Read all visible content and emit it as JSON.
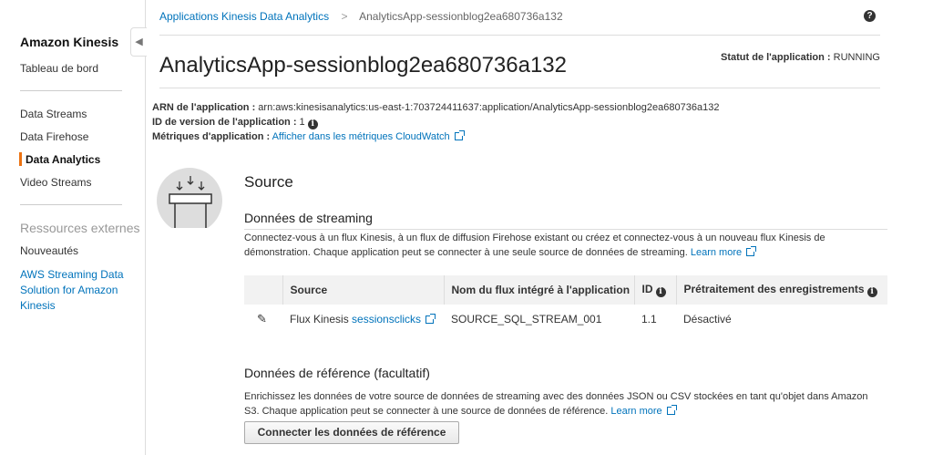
{
  "sidebar": {
    "title": "Amazon Kinesis",
    "dashboard": "Tableau de bord",
    "items": [
      "Data Streams",
      "Data Firehose",
      "Data Analytics",
      "Video Streams"
    ],
    "resources_heading": "Ressources externes",
    "links": [
      "Nouveautés",
      "AWS Streaming Data Solution for Amazon Kinesis"
    ]
  },
  "breadcrumb": {
    "parent": "Applications Kinesis Data Analytics",
    "current": "AnalyticsApp-sessionblog2ea680736a132"
  },
  "header": {
    "title": "AnalyticsApp-sessionblog2ea680736a132",
    "status_label": "Statut de l'application :",
    "status_value": "RUNNING"
  },
  "details": {
    "arn_label": "ARN de l'application :",
    "arn_value": "arn:aws:kinesisanalytics:us-east-1:703724411637:application/AnalyticsApp-sessionblog2ea680736a132",
    "version_label": "ID de version de l'application :",
    "version_value": "1",
    "metrics_label": "Métriques d'application :",
    "metrics_link": "Afficher dans les métriques CloudWatch"
  },
  "source": {
    "heading": "Source",
    "streaming_heading": "Données de streaming",
    "streaming_desc": "Connectez-vous à un flux Kinesis, à un flux de diffusion Firehose existant ou créez et connectez-vous à un nouveau flux Kinesis de démonstration. Chaque application peut se connecter à une seule source de données de streaming.",
    "learn_more": "Learn more",
    "table": {
      "headers": [
        "Source",
        "Nom du flux intégré à l'application",
        "ID",
        "Prétraitement des enregistrements"
      ],
      "row": {
        "source_prefix": "Flux Kinesis",
        "source_link": "sessionsclicks",
        "stream_name": "SOURCE_SQL_STREAM_001",
        "id": "1.1",
        "preprocessing": "Désactivé"
      }
    },
    "reference_heading": "Données de référence (facultatif)",
    "reference_desc": "Enrichissez les données de votre source de données de streaming avec des données JSON ou CSV stockées en tant qu'objet dans Amazon S3. Chaque application peut se connecter à une source de données de référence.",
    "reference_learn_more": "Learn more",
    "connect_button": "Connecter les données de référence"
  }
}
